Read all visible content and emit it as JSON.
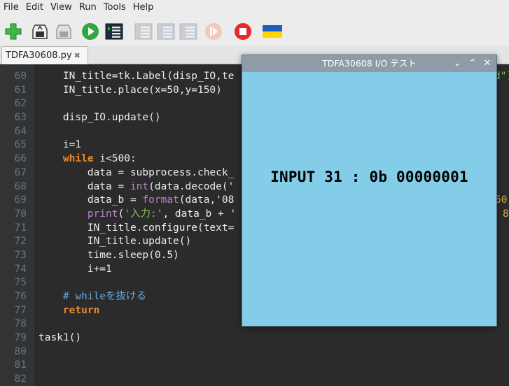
{
  "menu": [
    "File",
    "Edit",
    "View",
    "Run",
    "Tools",
    "Help"
  ],
  "toolbar": {
    "buttons": [
      {
        "name": "new-file-button",
        "icon": "plus-icon"
      },
      {
        "name": "open-file-button",
        "icon": "folder-icon"
      },
      {
        "name": "save-file-button",
        "icon": "save-icon"
      },
      {
        "name": "run-button",
        "icon": "play-icon"
      },
      {
        "name": "debug-button",
        "icon": "debug-icon"
      },
      {
        "name": "step-over-button",
        "icon": "step-over-icon"
      },
      {
        "name": "step-into-button",
        "icon": "step-into-icon"
      },
      {
        "name": "step-out-button",
        "icon": "step-out-icon"
      },
      {
        "name": "resume-button",
        "icon": "resume-icon"
      },
      {
        "name": "stop-button",
        "icon": "stop-icon"
      },
      {
        "name": "language-flag-button",
        "icon": "ukraine-flag-icon"
      }
    ]
  },
  "tab": {
    "label": "TDFA30608.py",
    "close": "✖"
  },
  "editor": {
    "lines": [
      {
        "n": "60",
        "segs": [
          {
            "t": "    IN_title=tk.Label(disp_IO,te",
            "c": ""
          }
        ]
      },
      {
        "n": "61",
        "segs": [
          {
            "t": "    IN_title.place(x=50,y=150)",
            "c": ""
          }
        ]
      },
      {
        "n": "62",
        "segs": []
      },
      {
        "n": "63",
        "segs": [
          {
            "t": "    disp_IO.update()",
            "c": ""
          }
        ]
      },
      {
        "n": "64",
        "segs": []
      },
      {
        "n": "65",
        "segs": [
          {
            "t": "    i=1",
            "c": ""
          }
        ]
      },
      {
        "n": "66",
        "segs": [
          {
            "t": "    ",
            "c": ""
          },
          {
            "t": "while",
            "c": "kw"
          },
          {
            "t": " i<500:",
            "c": ""
          }
        ]
      },
      {
        "n": "67",
        "segs": [
          {
            "t": "        data = subprocess.check_",
            "c": ""
          }
        ]
      },
      {
        "n": "68",
        "segs": [
          {
            "t": "        data = ",
            "c": ""
          },
          {
            "t": "int",
            "c": "bi"
          },
          {
            "t": "(data.decode('",
            "c": ""
          }
        ]
      },
      {
        "n": "69",
        "segs": [
          {
            "t": "        data_b = ",
            "c": ""
          },
          {
            "t": "format",
            "c": "bi"
          },
          {
            "t": "(data,'08",
            "c": ""
          }
        ]
      },
      {
        "n": "70",
        "segs": [
          {
            "t": "        ",
            "c": ""
          },
          {
            "t": "print",
            "c": "bi"
          },
          {
            "t": "(",
            "c": ""
          },
          {
            "t": "'入力:'",
            "c": "str"
          },
          {
            "t": ", data_b + '",
            "c": ""
          }
        ]
      },
      {
        "n": "71",
        "segs": [
          {
            "t": "        IN_title.configure(text=",
            "c": ""
          }
        ]
      },
      {
        "n": "72",
        "segs": [
          {
            "t": "        IN_title.update()",
            "c": ""
          }
        ]
      },
      {
        "n": "73",
        "segs": [
          {
            "t": "        time.sleep(0.5)",
            "c": ""
          }
        ]
      },
      {
        "n": "74",
        "segs": [
          {
            "t": "        i+=1",
            "c": ""
          }
        ]
      },
      {
        "n": "75",
        "segs": []
      },
      {
        "n": "76",
        "segs": [
          {
            "t": "    ",
            "c": ""
          },
          {
            "t": "# whileを抜ける",
            "c": "com"
          }
        ]
      },
      {
        "n": "77",
        "segs": [
          {
            "t": "    ",
            "c": ""
          },
          {
            "t": "return",
            "c": "kw"
          }
        ]
      },
      {
        "n": "78",
        "segs": []
      },
      {
        "n": "79",
        "segs": [
          {
            "t": "task1()",
            "c": ""
          }
        ]
      },
      {
        "n": "80",
        "segs": []
      },
      {
        "n": "81",
        "segs": []
      },
      {
        "n": "82",
        "segs": []
      }
    ],
    "right_snippets": [
      {
        "line": 0,
        "text": "d\")"
      },
      {
        "line": 9,
        "text": "60"
      },
      {
        "line": 10,
        "text": "8"
      }
    ]
  },
  "io_window": {
    "title": "TDFA30608 I/O テスト",
    "btn_min": "⌄",
    "btn_max": "⌃",
    "btn_close": "✕",
    "value_text": "INPUT 31 : 0b 00000001",
    "bg_color": "#84cde9"
  }
}
